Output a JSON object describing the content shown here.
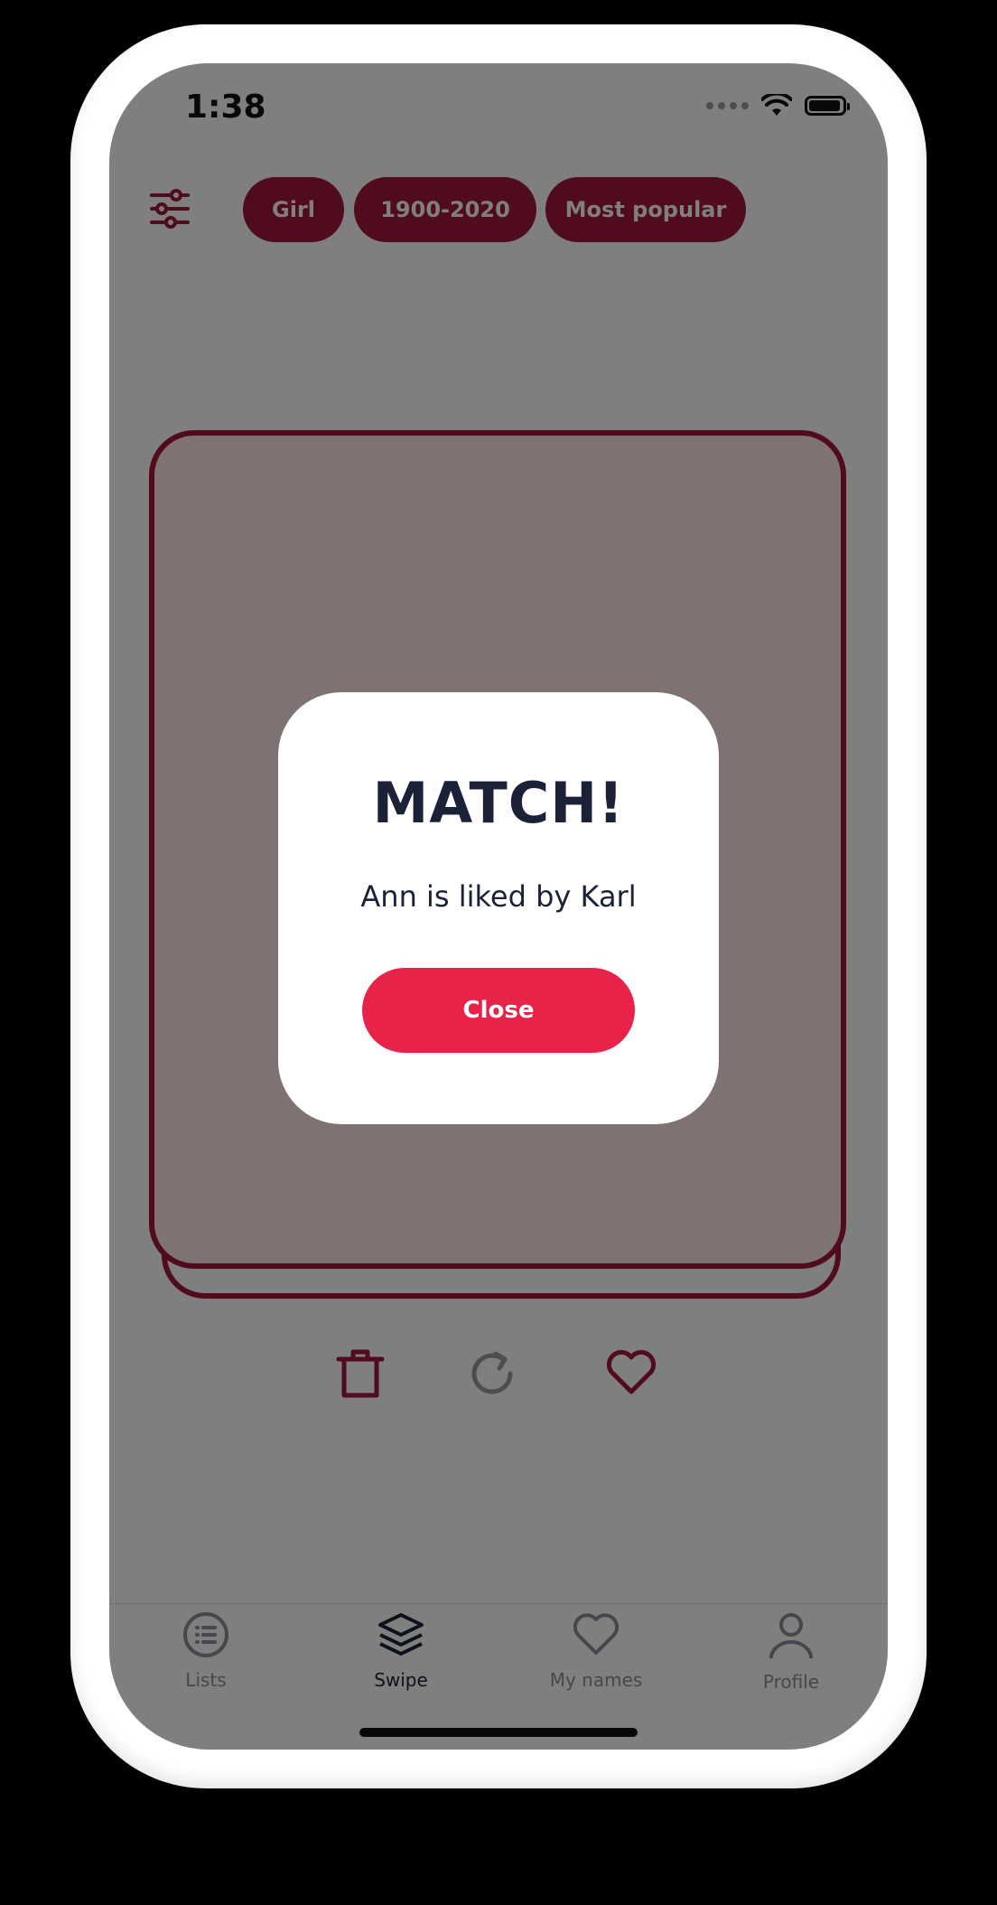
{
  "status_bar": {
    "time": "1:38"
  },
  "filters": {
    "chips": [
      "Girl",
      "1900-2020",
      "Most popular"
    ]
  },
  "modal": {
    "title": "MATCH!",
    "message": "Ann is liked by Karl",
    "close_label": "Close"
  },
  "tabs": [
    {
      "label": "Lists",
      "icon": "list-icon",
      "active": false
    },
    {
      "label": "Swipe",
      "icon": "layers-icon",
      "active": true
    },
    {
      "label": "My names",
      "icon": "heart-icon",
      "active": false
    },
    {
      "label": "Profile",
      "icon": "user-icon",
      "active": false
    }
  ],
  "colors": {
    "accent": "#a1163a",
    "button": "#e8234a",
    "text_dark": "#1b2238",
    "card_fill": "#fde4e4"
  }
}
